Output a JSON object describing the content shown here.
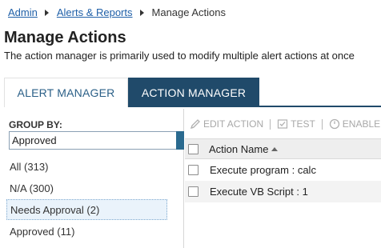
{
  "breadcrumb": {
    "items": [
      "Admin",
      "Alerts & Reports",
      "Manage Actions"
    ]
  },
  "page": {
    "title": "Manage Actions",
    "description": "The action manager is primarily used to modify multiple alert actions at once"
  },
  "tabs": [
    {
      "label": "ALERT MANAGER",
      "active": false
    },
    {
      "label": "ACTION MANAGER",
      "active": true
    }
  ],
  "group_by": {
    "label": "GROUP BY:",
    "selected": "Approved",
    "items": [
      {
        "label": "All (313)"
      },
      {
        "label": "N/A (300)"
      },
      {
        "label": "Needs Approval (2)"
      },
      {
        "label": "Approved (11)"
      }
    ]
  },
  "toolbar": {
    "edit_label": "EDIT ACTION",
    "test_label": "TEST",
    "enable_label": "ENABLE"
  },
  "grid": {
    "column_name": "Action Name",
    "rows": [
      {
        "name": "Execute program : calc"
      },
      {
        "name": "Execute VB Script : 1"
      }
    ]
  },
  "colors": {
    "accent": "#204a6a",
    "link": "#2060a8",
    "tab_inactive_text": "#2a5f87"
  },
  "icons": [
    "pencil-icon",
    "test-icon",
    "enable-icon",
    "sort-ascending-icon",
    "dropdown-arrow-icon"
  ]
}
